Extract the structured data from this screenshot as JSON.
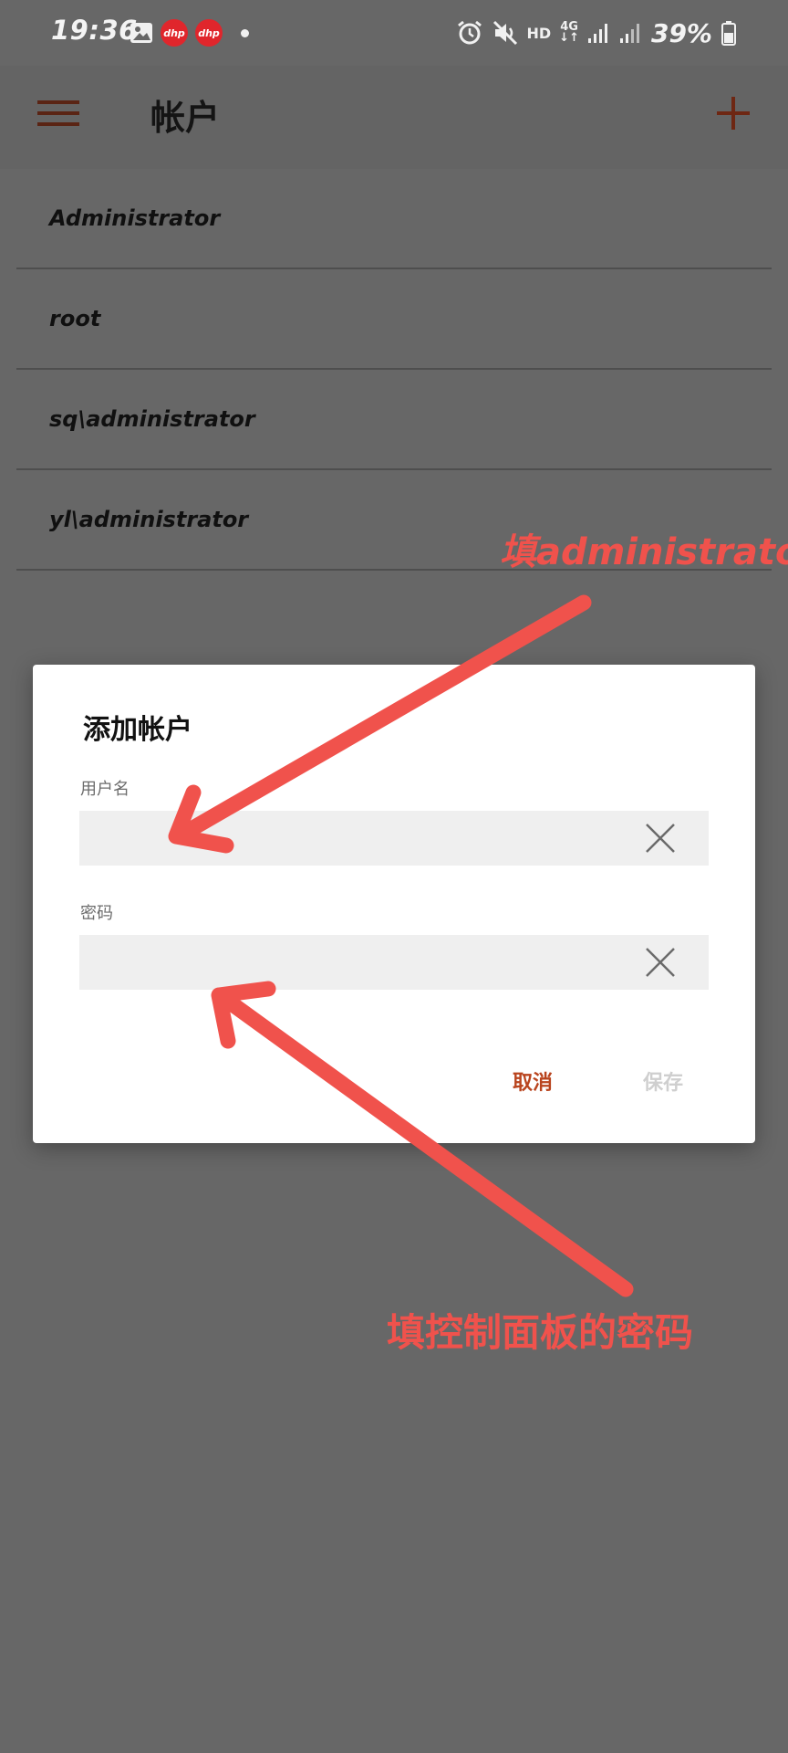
{
  "status_bar": {
    "time": "19:36",
    "app_badge_text": "dhp",
    "hd_label": "HD",
    "network_label": "4G",
    "battery_percent": "39%",
    "icons": [
      "image-icon",
      "app-badge",
      "app-badge",
      "notification-dot",
      "alarm-icon",
      "mute-icon",
      "signal-icon",
      "battery-icon"
    ]
  },
  "appbar": {
    "title": "帐户",
    "menu_icon": "menu-icon",
    "add_icon": "add-icon"
  },
  "accounts": {
    "items": [
      {
        "label": "Administrator"
      },
      {
        "label": "root"
      },
      {
        "label": "sq\\administrator"
      },
      {
        "label": "yl\\administrator"
      }
    ]
  },
  "dialog": {
    "title": "添加帐户",
    "username_label": "用户名",
    "username_value": "",
    "password_label": "密码",
    "password_value": "",
    "cancel_label": "取消",
    "save_label": "保存"
  },
  "annotations": {
    "top_text": "填administrator",
    "bottom_text": "填控制面板的密码",
    "color": "#f0524c"
  },
  "colors": {
    "accent": "#b9441e",
    "background_dim": "#676767",
    "disabled": "#cfcfcf"
  }
}
